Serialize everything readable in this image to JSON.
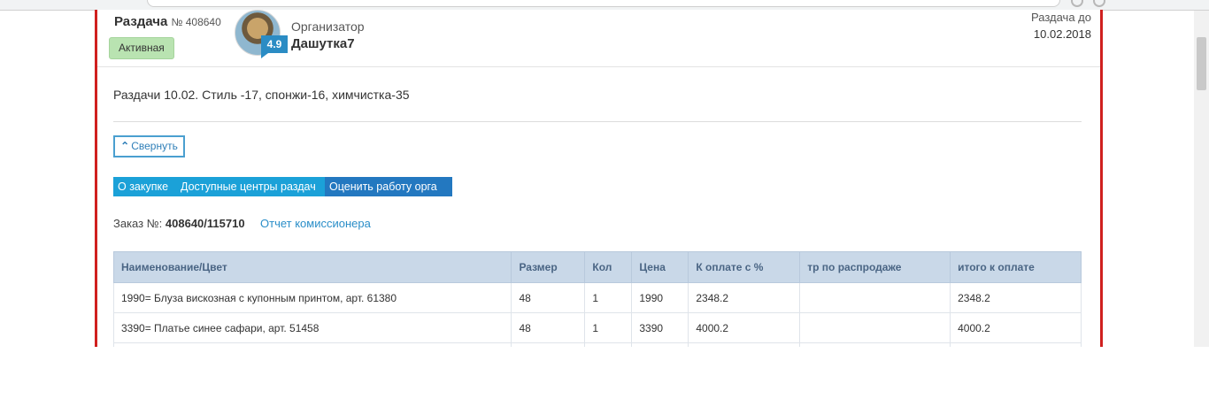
{
  "header": {
    "title": "Раздача",
    "number": "№ 408640",
    "status": "Активная",
    "organizer_label": "Организатор",
    "organizer_name": "Дашутка7",
    "rating": "4.9",
    "until_label": "Раздача до",
    "until_date": "10.02.2018"
  },
  "description": "Раздачи 10.02. Стиль -17, спонжи-16, химчистка-35",
  "collapse_label": "Свернуть",
  "buttons": {
    "about": "О закупке",
    "centers": "Доступные центры раздач",
    "rate": "Оценить работу орга"
  },
  "order": {
    "label": "Заказ №:",
    "number": "408640/115710",
    "report_link": "Отчет комиссионера"
  },
  "table": {
    "headers": [
      "Наименование/Цвет",
      "Размер",
      "Кол",
      "Цена",
      "К оплате с %",
      "тр по распродаже",
      "итого к оплате"
    ],
    "rows": [
      [
        "1990= Блуза вискозная с купонным принтом, арт. 61380",
        "48",
        "1",
        "1990",
        "2348.2",
        "",
        "2348.2"
      ],
      [
        "3390= Платье синее сафари, арт. 51458",
        "48",
        "1",
        "3390",
        "4000.2",
        "",
        "4000.2"
      ],
      [
        "",
        "",
        "",
        "",
        "",
        "",
        ""
      ]
    ]
  },
  "colors": {
    "card_border": "#d0201f",
    "status_badge": "#b9e3b1",
    "button_primary": "#1ba1d8",
    "button_rate": "#2378c0",
    "table_header": "#c9d8e8",
    "link": "#2a8ec8"
  }
}
